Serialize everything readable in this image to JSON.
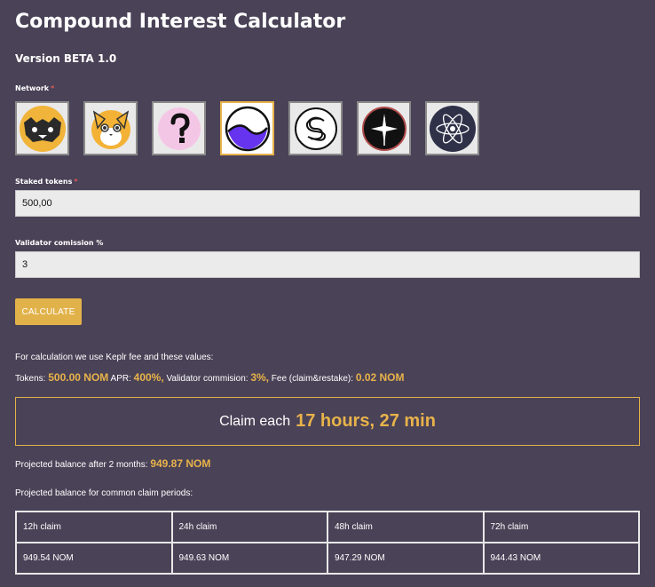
{
  "title": "Compound Interest Calculator",
  "version": "Version BETA 1.0",
  "network_label": "Network",
  "required_mark": "*",
  "networks": [
    {
      "name": "network-1",
      "icon": "wolf-logo-icon",
      "selected": false
    },
    {
      "name": "network-2",
      "icon": "cat-logo-icon",
      "selected": false
    },
    {
      "name": "network-3",
      "icon": "question-mark-icon",
      "selected": false
    },
    {
      "name": "network-4",
      "icon": "swirl-logo-icon",
      "selected": true
    },
    {
      "name": "network-5",
      "icon": "s-logo-icon",
      "selected": false
    },
    {
      "name": "network-6",
      "icon": "star-logo-icon",
      "selected": false
    },
    {
      "name": "network-7",
      "icon": "atom-logo-icon",
      "selected": false
    }
  ],
  "staked_label": "Staked tokens",
  "staked_value": "500,00",
  "commission_label": "Validator comission %",
  "commission_value": "3",
  "calculate_label": "CALCULATE",
  "info_text": "For calculation we use Keplr fee and these values:",
  "params": {
    "tokens_label": "Tokens:",
    "tokens_value": "500.00 NOM",
    "apr_label": "APR:",
    "apr_value": "400%,",
    "commission_label": "Validator commision:",
    "commission_value": "3%,",
    "fee_label": "Fee (claim&restake):",
    "fee_value": "0.02 NOM"
  },
  "claim": {
    "prefix": "Claim each",
    "value": "17 hours, 27 min"
  },
  "projected": {
    "label": "Projected balance after 2 months:",
    "value": "949.87 NOM"
  },
  "periods_label": "Projected balance for common claim periods:",
  "periods": [
    {
      "label": "12h claim",
      "value": "949.54 NOM"
    },
    {
      "label": "24h claim",
      "value": "949.63 NOM"
    },
    {
      "label": "48h claim",
      "value": "947.29 NOM"
    },
    {
      "label": "72h claim",
      "value": "944.43 NOM"
    }
  ],
  "colors": {
    "background": "#4a4257",
    "accent": "#e8b34a"
  }
}
